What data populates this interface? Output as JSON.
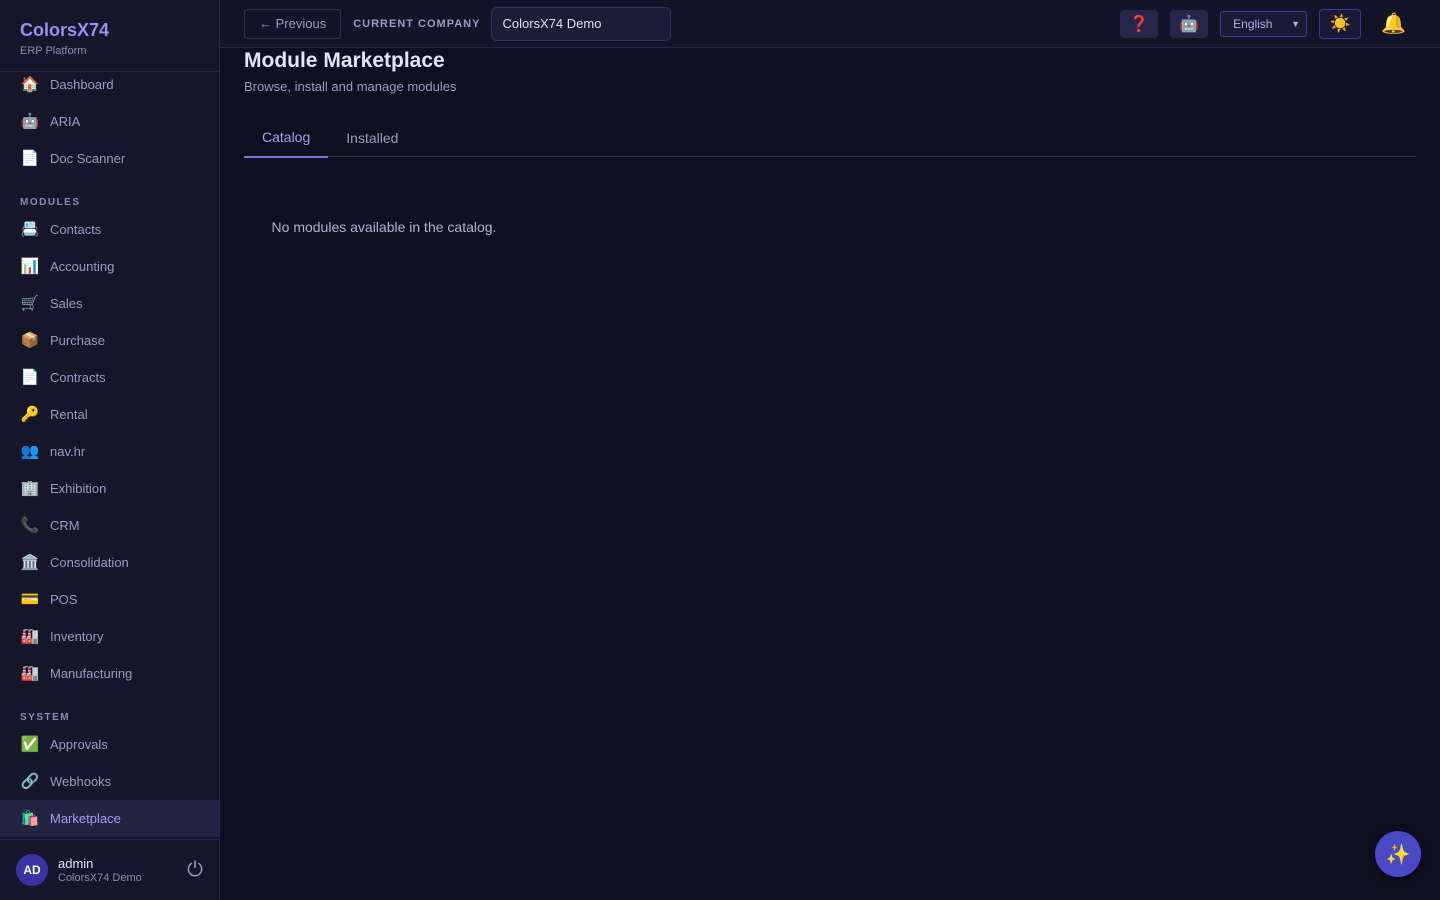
{
  "brand": {
    "name": "ColorsX74",
    "subtitle": "ERP Platform"
  },
  "sidebar": {
    "top_items": [
      {
        "icon": "🏠",
        "icon_name": "home-icon",
        "label": "Dashboard"
      },
      {
        "icon": "🤖",
        "icon_name": "robot-icon",
        "label": "ARIA"
      },
      {
        "icon": "📄",
        "icon_name": "document-icon",
        "label": "Doc Scanner"
      }
    ],
    "modules_label": "MODULES",
    "modules": [
      {
        "icon": "📇",
        "icon_name": "card-index-icon",
        "label": "Contacts"
      },
      {
        "icon": "📊",
        "icon_name": "bar-chart-icon",
        "label": "Accounting"
      },
      {
        "icon": "🛒",
        "icon_name": "cart-icon",
        "label": "Sales"
      },
      {
        "icon": "📦",
        "icon_name": "package-icon",
        "label": "Purchase"
      },
      {
        "icon": "📄",
        "icon_name": "document-icon",
        "label": "Contracts"
      },
      {
        "icon": "🔑",
        "icon_name": "key-icon",
        "label": "Rental"
      },
      {
        "icon": "👥",
        "icon_name": "people-icon",
        "label": "nav.hr"
      },
      {
        "icon": "🏢",
        "icon_name": "office-building-icon",
        "label": "Exhibition"
      },
      {
        "icon": "📞",
        "icon_name": "phone-icon",
        "label": "CRM"
      },
      {
        "icon": "🏛️",
        "icon_name": "classical-building-icon",
        "label": "Consolidation"
      },
      {
        "icon": "💳",
        "icon_name": "credit-card-icon",
        "label": "POS"
      },
      {
        "icon": "🏭",
        "icon_name": "factory-icon",
        "label": "Inventory"
      },
      {
        "icon": "🏭",
        "icon_name": "factory-icon",
        "label": "Manufacturing"
      }
    ],
    "system_label": "SYSTEM",
    "system": [
      {
        "icon": "✅",
        "icon_name": "check-icon",
        "label": "Approvals"
      },
      {
        "icon": "🔗",
        "icon_name": "link-icon",
        "label": "Webhooks"
      },
      {
        "icon": "🛍️",
        "icon_name": "shopping-bags-icon",
        "label": "Marketplace",
        "active": true
      }
    ]
  },
  "user": {
    "initials": "AD",
    "name": "admin",
    "company": "ColorsX74 Demo",
    "logout_icon": "⏻"
  },
  "topbar": {
    "previous_label": "← Previous",
    "company_label": "CURRENT COMPANY",
    "company_value": "ColorsX74 Demo",
    "help_icon": "❓",
    "assistant_icon": "🤖",
    "language": "English",
    "theme_icon": "☀️",
    "bell_icon": "🔔"
  },
  "page": {
    "title": "Module Marketplace",
    "subtitle": "Browse, install and manage modules",
    "tabs": [
      {
        "label": "Catalog",
        "active": true
      },
      {
        "label": "Installed",
        "active": false
      }
    ],
    "empty_message": "No modules available in the catalog."
  },
  "fab_icon": "✨",
  "colors": {
    "accent": "#7f6fe0",
    "background": "#0f0f1f",
    "sidebar": "#16162a"
  }
}
